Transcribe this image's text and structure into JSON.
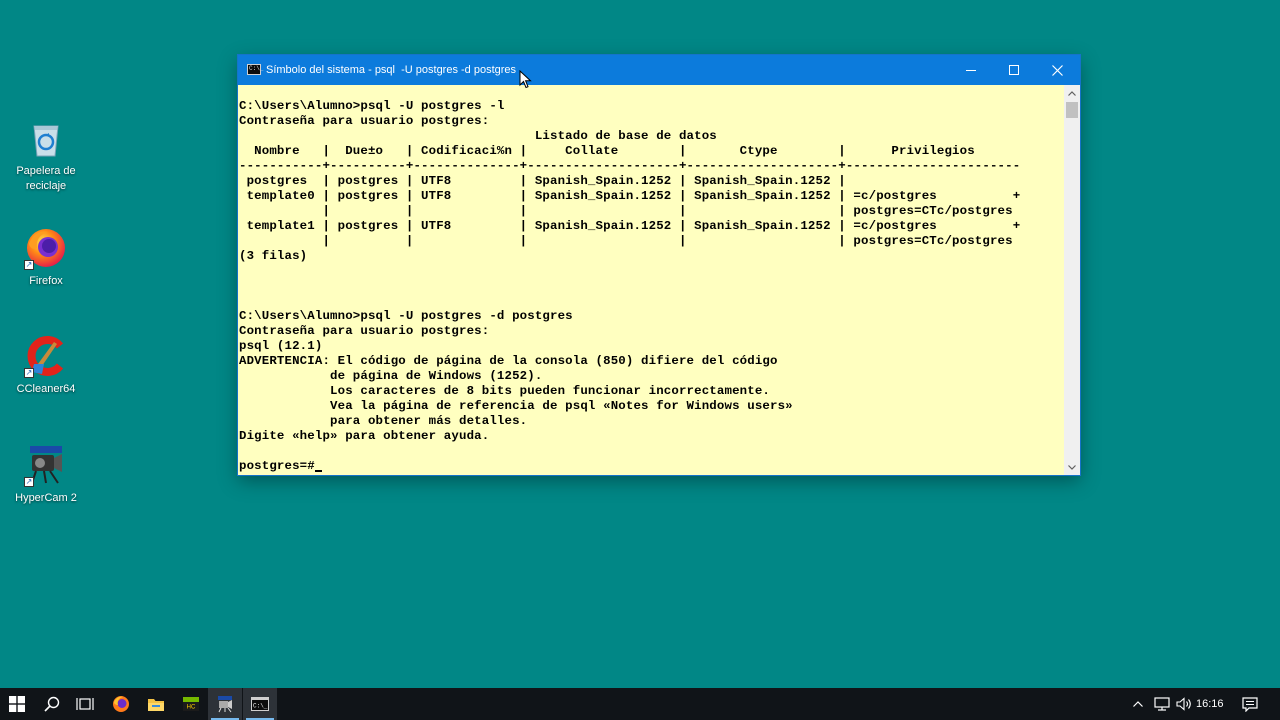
{
  "desktop": {
    "icons": [
      {
        "label_line1": "Papelera de",
        "label_line2": "reciclaje",
        "icon": "recycle-bin-icon"
      },
      {
        "label_line1": "Firefox",
        "label_line2": "",
        "icon": "firefox-icon"
      },
      {
        "label_line1": "CCleaner64",
        "label_line2": "",
        "icon": "ccleaner-icon"
      },
      {
        "label_line1": "HyperCam 2",
        "label_line2": "",
        "icon": "hypercam-icon"
      }
    ]
  },
  "window": {
    "title": "Símbolo del sistema - psql  -U postgres -d postgres",
    "icon_text": "C:\\_",
    "lines": [
      "C:\\Users\\Alumno>psql -U postgres -l",
      "Contraseña para usuario postgres:",
      "                                       Listado de base de datos",
      "  Nombre   |  Due±o   | Codificaci%n |     Collate        |       Ctype        |      Privilegios",
      "-----------+----------+--------------+--------------------+--------------------+-----------------------",
      " postgres  | postgres | UTF8         | Spanish_Spain.1252 | Spanish_Spain.1252 |",
      " template0 | postgres | UTF8         | Spanish_Spain.1252 | Spanish_Spain.1252 | =c/postgres          +",
      "           |          |              |                    |                    | postgres=CTc/postgres",
      " template1 | postgres | UTF8         | Spanish_Spain.1252 | Spanish_Spain.1252 | =c/postgres          +",
      "           |          |              |                    |                    | postgres=CTc/postgres",
      "(3 filas)",
      "",
      "",
      "",
      "C:\\Users\\Alumno>psql -U postgres -d postgres",
      "Contraseña para usuario postgres:",
      "psql (12.1)",
      "ADVERTENCIA: El código de página de la consola (850) difiere del código",
      "            de página de Windows (1252).",
      "            Los caracteres de 8 bits pueden funcionar incorrectamente.",
      "            Vea la página de referencia de psql «Notes for Windows users»",
      "            para obtener más detalles.",
      "Digite «help» para obtener ayuda.",
      ""
    ],
    "prompt": "postgres=#"
  },
  "taskbar": {
    "items": [
      "start-icon",
      "search-icon",
      "task-view-icon",
      "firefox-icon",
      "file-explorer-icon",
      "hypercam-icon",
      "cmd-app-icon",
      "terminal-icon"
    ],
    "clock": "16:16"
  }
}
